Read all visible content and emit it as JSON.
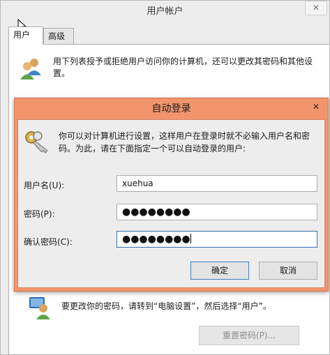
{
  "window": {
    "title": "用户帐户",
    "close_glyph": "✕"
  },
  "tabs": [
    {
      "label": "用户"
    },
    {
      "label": "高级"
    }
  ],
  "outer": {
    "description": "用下列表授予或拒绝用户访问你的计算机，还可以更改其密码和其他设置。",
    "bottom_note": "要更改你的密码，请转到“电脑设置”，然后选择“用户”。",
    "reset_password_label": "重置密码(P)..."
  },
  "dialog": {
    "title": "自动登录",
    "close_glyph": "✕",
    "description": "你可以对计算机进行设置，这样用户在登录时就不必输入用户名和密码。为此，请在下面指定一个可以自动登录的用户:",
    "fields": [
      {
        "label": "用户名(U):",
        "value": "xuehua"
      },
      {
        "label": "密码(P):",
        "value": "●●●●●●●●"
      },
      {
        "label": "确认密码(C):",
        "value": "●●●●●●●●"
      }
    ],
    "ok_label": "确定",
    "cancel_label": "取消"
  },
  "colors": {
    "dialog_accent": "#f2956c",
    "window_bg": "#ededed",
    "focus_border": "#2f6fb5"
  },
  "icons": [
    "users-icon",
    "keys-icon",
    "mouse-cursor-icon"
  ]
}
